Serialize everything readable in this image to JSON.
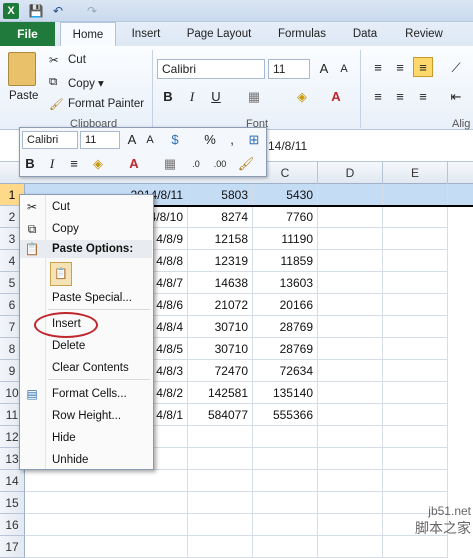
{
  "titlebar": {
    "logo": "X",
    "save_icon": "💾",
    "undo_icon": "↶",
    "redo_icon": "↷"
  },
  "tabs": {
    "file": "File",
    "items": [
      "Home",
      "Insert",
      "Page Layout",
      "Formulas",
      "Data",
      "Review"
    ]
  },
  "ribbon": {
    "paste": "Paste",
    "cut": "Cut",
    "copy": "Copy ▾",
    "format_painter": "Format Painter",
    "clipboard": "Clipboard",
    "font_name": "Calibri",
    "font_size": "11",
    "font_group": "Font",
    "alignment_group": "Alig"
  },
  "formula_bar": {
    "value": "14/8/11"
  },
  "mini_toolbar": {
    "font_name": "Calibri",
    "font_size": "11"
  },
  "columns": [
    "C",
    "D",
    "E"
  ],
  "rows": [
    {
      "num": "1",
      "a": "2014/8/11",
      "b": "5803",
      "c": "5430"
    },
    {
      "num": "2",
      "a": "4/8/10",
      "b": "8274",
      "c": "7760"
    },
    {
      "num": "3",
      "a": "4/8/9",
      "b": "12158",
      "c": "11190"
    },
    {
      "num": "4",
      "a": "4/8/8",
      "b": "12319",
      "c": "11859"
    },
    {
      "num": "5",
      "a": "4/8/7",
      "b": "14638",
      "c": "13603"
    },
    {
      "num": "6",
      "a": "4/8/6",
      "b": "21072",
      "c": "20166"
    },
    {
      "num": "7",
      "a": "4/8/4",
      "b": "30710",
      "c": "28769"
    },
    {
      "num": "8",
      "a": "4/8/5",
      "b": "30710",
      "c": "28769"
    },
    {
      "num": "9",
      "a": "4/8/3",
      "b": "72470",
      "c": "72634"
    },
    {
      "num": "10",
      "a": "4/8/2",
      "b": "142581",
      "c": "135140"
    },
    {
      "num": "11",
      "a": "4/8/1",
      "b": "584077",
      "c": "555366"
    },
    {
      "num": "12",
      "a": "",
      "b": "",
      "c": ""
    },
    {
      "num": "13",
      "a": "",
      "b": "",
      "c": ""
    },
    {
      "num": "14",
      "a": "",
      "b": "",
      "c": ""
    },
    {
      "num": "15",
      "a": "",
      "b": "",
      "c": ""
    },
    {
      "num": "16",
      "a": "",
      "b": "",
      "c": ""
    },
    {
      "num": "17",
      "a": "",
      "b": "",
      "c": ""
    }
  ],
  "context_menu": {
    "cut": "Cut",
    "copy": "Copy",
    "paste_options": "Paste Options:",
    "paste_special": "Paste Special...",
    "insert": "Insert",
    "delete": "Delete",
    "clear_contents": "Clear Contents",
    "format_cells": "Format Cells...",
    "row_height": "Row Height...",
    "hide": "Hide",
    "unhide": "Unhide"
  },
  "watermark": {
    "line1": "jb51.net",
    "line2": "脚本之家"
  },
  "colors": {
    "file_green": "#1f7a3c",
    "selection": "#c5dcf5",
    "highlight_circle": "#c0262d"
  }
}
